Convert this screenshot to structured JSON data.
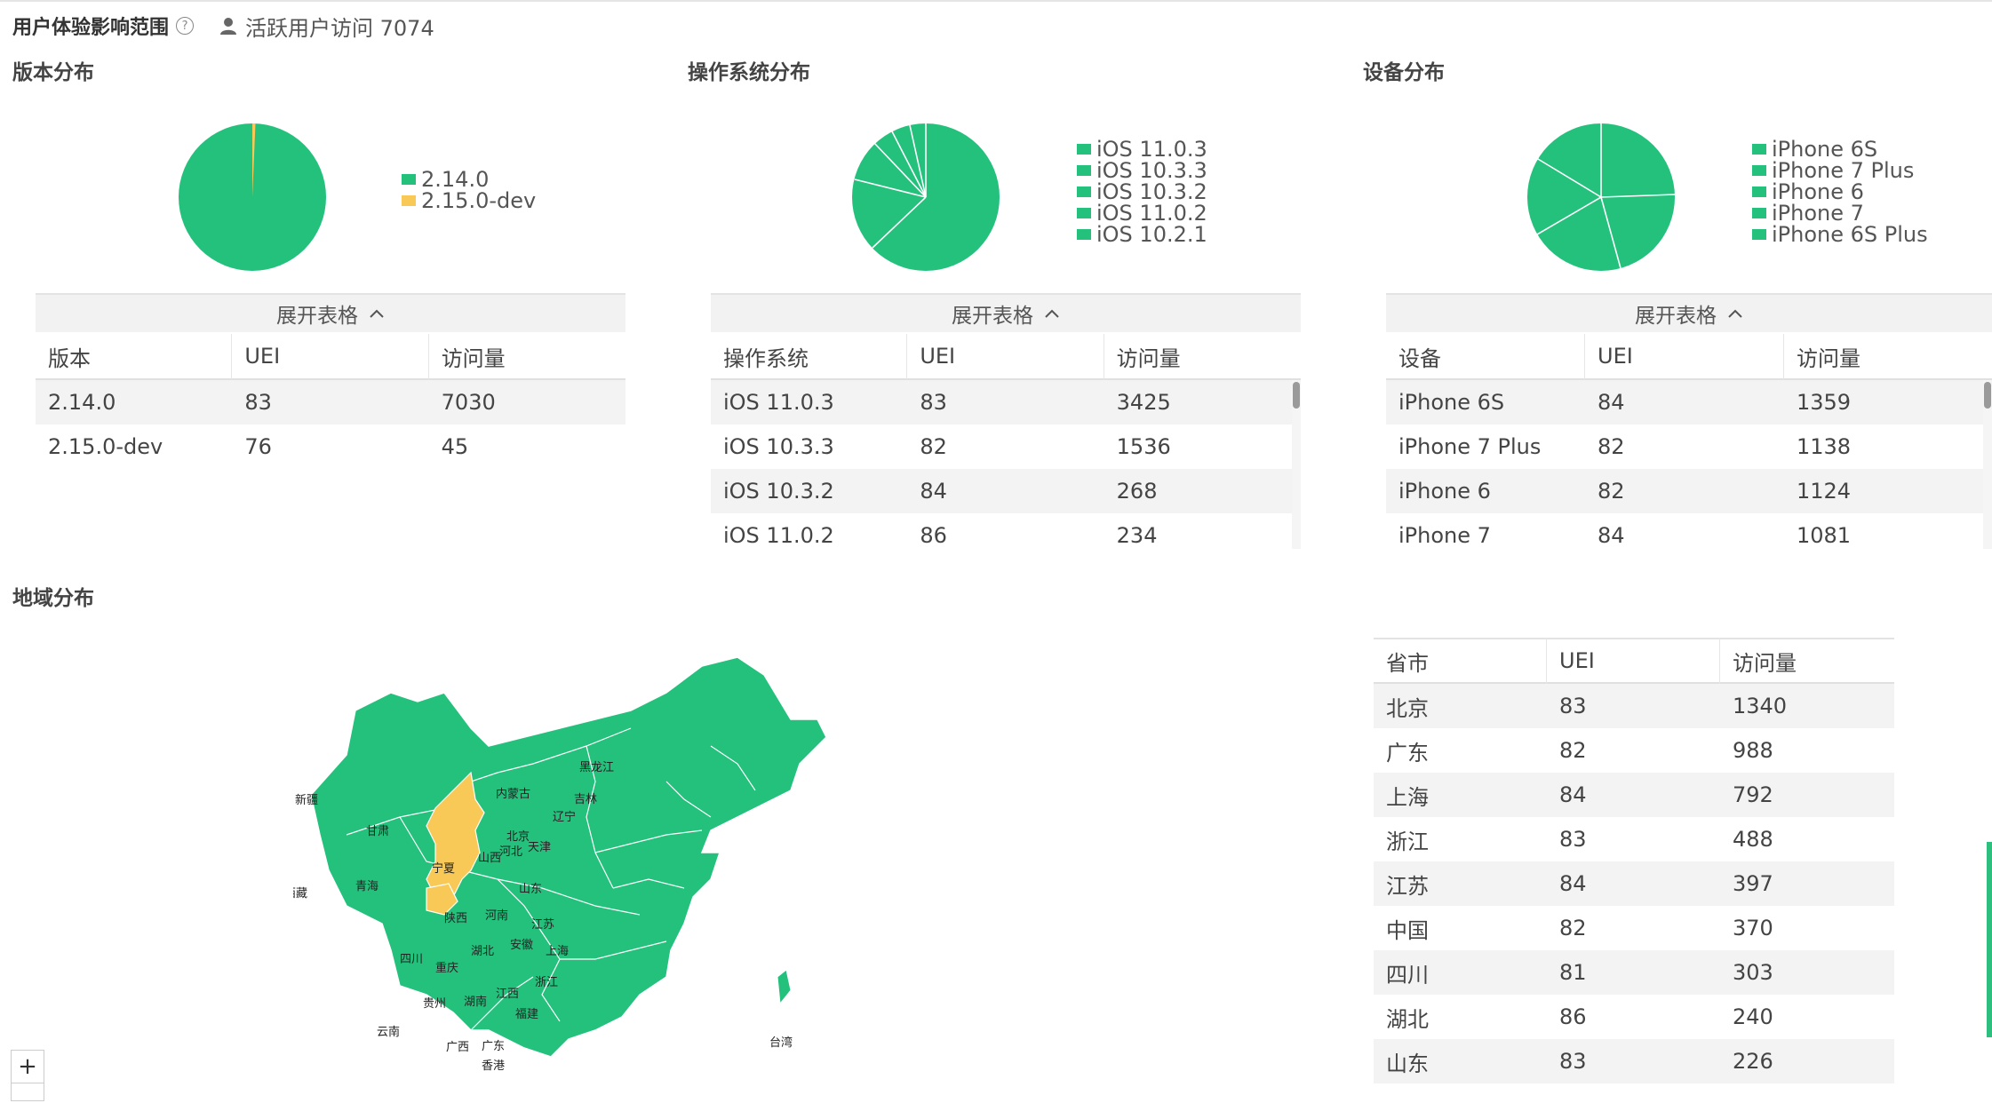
{
  "header": {
    "title": "用户体验影响范围",
    "active_label": "活跃用户访问 7074"
  },
  "colors": {
    "green": "#24c17c",
    "yellow": "#f8c957"
  },
  "panels": [
    {
      "title": "版本分布",
      "legend": [
        "2.14.0",
        "2.15.0-dev"
      ],
      "expand_label": "展开表格",
      "columns": [
        "版本",
        "UEI",
        "访问量"
      ],
      "rows": [
        [
          "2.14.0",
          "83",
          "7030"
        ],
        [
          "2.15.0-dev",
          "76",
          "45"
        ]
      ]
    },
    {
      "title": "操作系统分布",
      "legend": [
        "iOS 11.0.3",
        "iOS 10.3.3",
        "iOS 10.3.2",
        "iOS 11.0.2",
        "iOS 10.2.1"
      ],
      "expand_label": "展开表格",
      "columns": [
        "操作系统",
        "UEI",
        "访问量"
      ],
      "rows": [
        [
          "iOS 11.0.3",
          "83",
          "3425"
        ],
        [
          "iOS 10.3.3",
          "82",
          "1536"
        ],
        [
          "iOS 10.3.2",
          "84",
          "268"
        ],
        [
          "iOS 11.0.2",
          "86",
          "234"
        ]
      ]
    },
    {
      "title": "设备分布",
      "legend": [
        "iPhone 6S",
        "iPhone 7 Plus",
        "iPhone 6",
        "iPhone 7",
        "iPhone 6S Plus"
      ],
      "expand_label": "展开表格",
      "columns": [
        "设备",
        "UEI",
        "访问量"
      ],
      "rows": [
        [
          "iPhone 6S",
          "84",
          "1359"
        ],
        [
          "iPhone 7 Plus",
          "82",
          "1138"
        ],
        [
          "iPhone 6",
          "82",
          "1124"
        ],
        [
          "iPhone 7",
          "84",
          "1081"
        ]
      ]
    }
  ],
  "region": {
    "title": "地域分布",
    "zoom_label": "+",
    "map_labels": [
      "新疆",
      "西藏",
      "青海",
      "甘肃",
      "内蒙古",
      "黑龙江",
      "吉林",
      "辽宁",
      "北京",
      "天津",
      "河北",
      "山西",
      "宁夏",
      "陕西",
      "山东",
      "河南",
      "江苏",
      "安徽",
      "上海",
      "湖北",
      "四川",
      "重庆",
      "浙江",
      "江西",
      "湖南",
      "贵州",
      "福建",
      "云南",
      "广西",
      "广东",
      "香港",
      "台湾"
    ],
    "columns": [
      "省市",
      "UEI",
      "访问量"
    ],
    "rows": [
      [
        "北京",
        "83",
        "1340"
      ],
      [
        "广东",
        "82",
        "988"
      ],
      [
        "上海",
        "84",
        "792"
      ],
      [
        "浙江",
        "83",
        "488"
      ],
      [
        "江苏",
        "84",
        "397"
      ],
      [
        "中国",
        "82",
        "370"
      ],
      [
        "四川",
        "81",
        "303"
      ],
      [
        "湖北",
        "86",
        "240"
      ],
      [
        "山东",
        "83",
        "226"
      ]
    ]
  }
}
